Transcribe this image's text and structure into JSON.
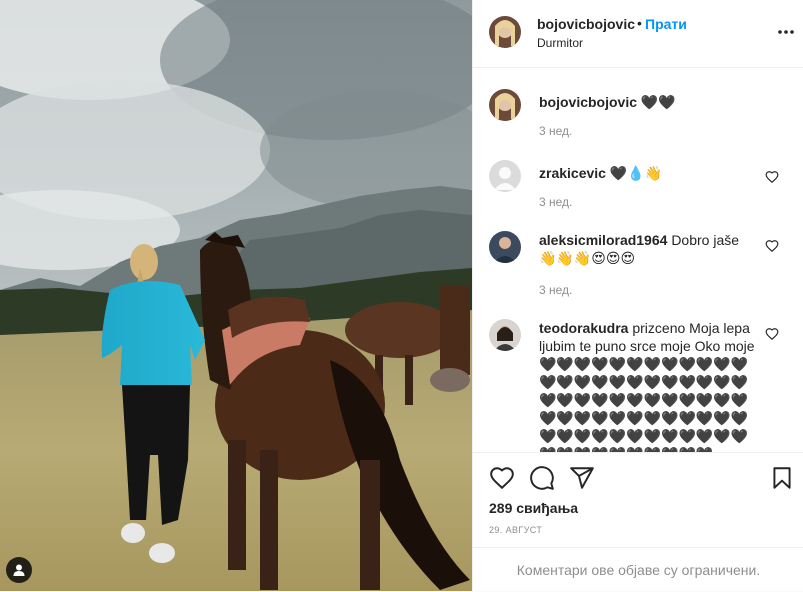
{
  "post": {
    "author": "bojovicbojovic",
    "dot": "•",
    "follow_label": "Прати",
    "location": "Durmitor",
    "more_icon": "more-horizontal-icon"
  },
  "comments": [
    {
      "user": "bojovicbojovic",
      "text": "🖤🖤",
      "time": "3 нед."
    },
    {
      "user": "zrakicevic",
      "text": "🖤💧👋",
      "time": "3 нед."
    },
    {
      "user": "aleksicmilorad1964",
      "text": "Dobro jaše 👋👋👋😍😍😍",
      "time": "3 нед."
    },
    {
      "user": "teodorakudra",
      "text": "prizceno Moja lepa ljubim te puno srce moje Oko moje 🖤🖤🖤🖤🖤🖤🖤🖤🖤🖤🖤🖤🖤🖤🖤🖤🖤🖤🖤🖤🖤🖤🖤🖤🖤🖤🖤🖤🖤🖤🖤🖤🖤🖤🖤🖤🖤🖤🖤🖤🖤🖤🖤🖤🖤🖤🖤🖤🖤🖤🖤🖤🖤🖤🖤🖤🖤🖤🖤🖤🖤🖤🖤🖤🖤🖤🖤🖤🖤🖤"
    }
  ],
  "actions": {
    "like_icon": "heart-icon",
    "comment_icon": "comment-icon",
    "share_icon": "share-icon",
    "save_icon": "bookmark-icon"
  },
  "likes_text": "289 свиђања",
  "date_text": "29. АВГУСТ",
  "footer_text": "Коментари ове објаве су ограничени.",
  "colors": {
    "accent": "#0095f6",
    "muted": "#8e8e8e",
    "text": "#262626",
    "border": "#efefef"
  }
}
